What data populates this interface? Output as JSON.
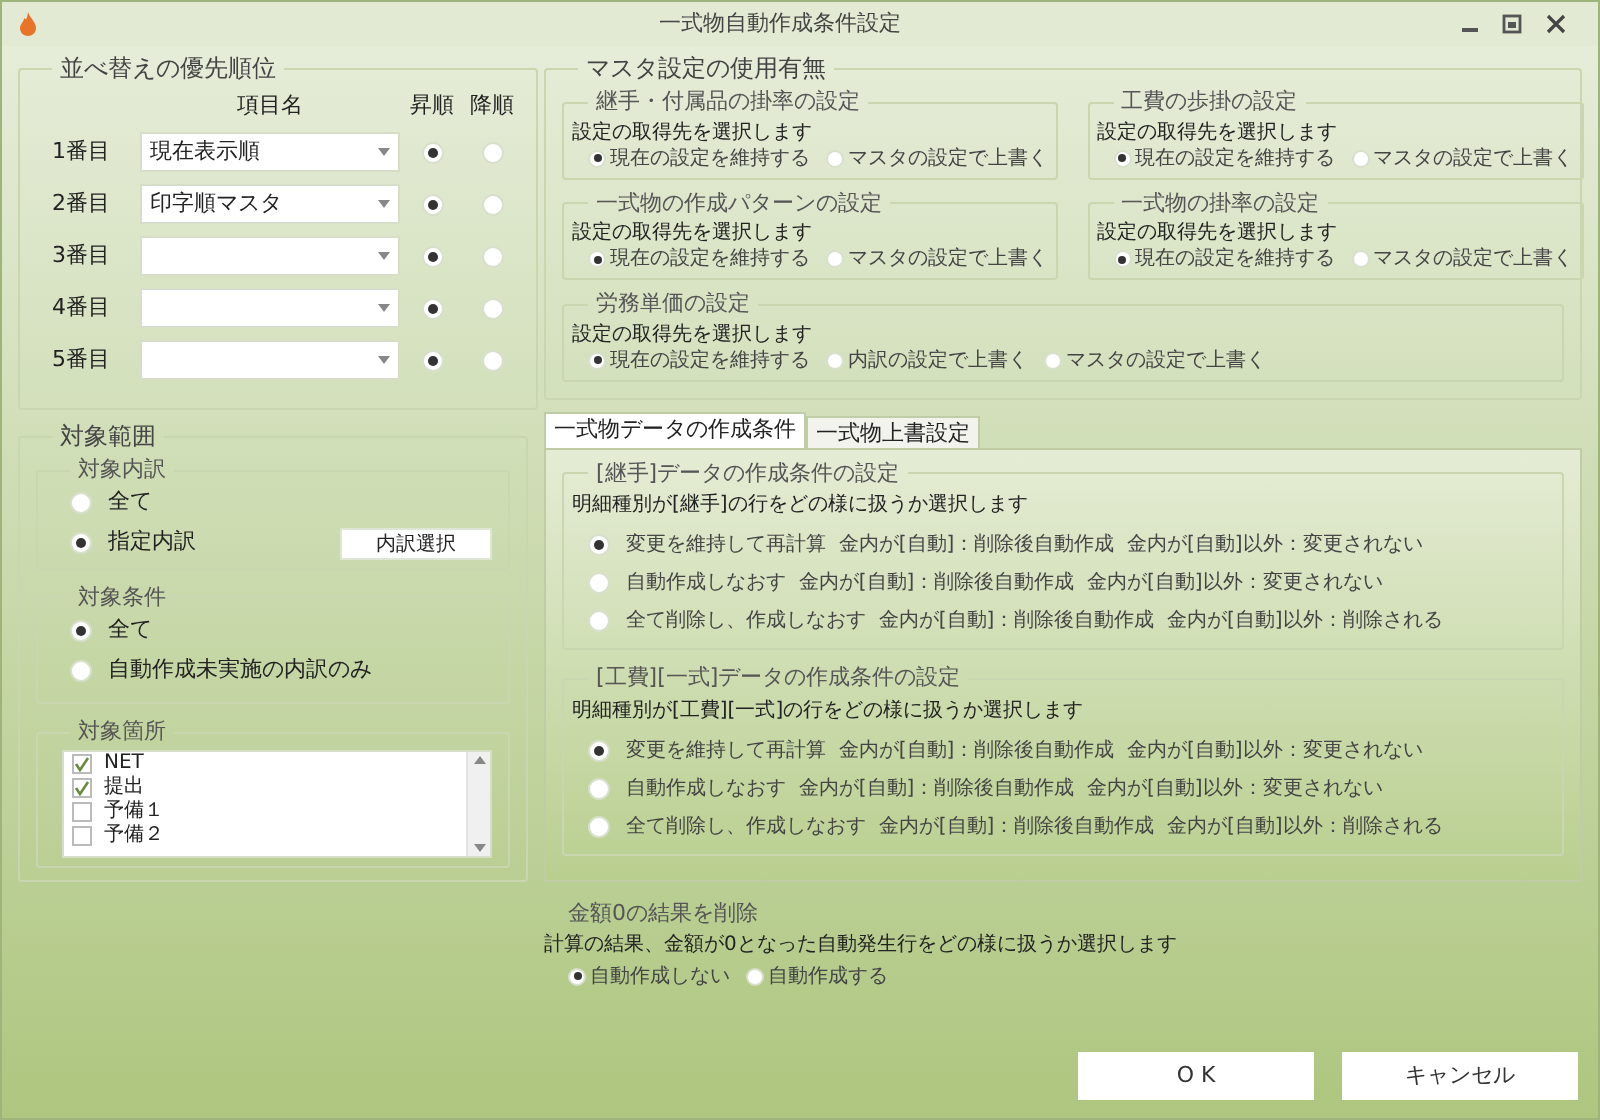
{
  "window": {
    "title": "一式物自動作成条件設定"
  },
  "sort_priority": {
    "title": "並べ替えの優先順位",
    "columns": [
      "項目名",
      "昇順",
      "降順"
    ],
    "rows": [
      {
        "label": "1番目",
        "value": "現在表示順",
        "ascending": true
      },
      {
        "label": "2番目",
        "value": "印字順マスタ",
        "ascending": true
      },
      {
        "label": "3番目",
        "ascending": true
      },
      {
        "label": "4番目",
        "ascending": true
      },
      {
        "label": "5番目",
        "ascending": true
      }
    ]
  },
  "target_range": {
    "title": "対象範囲",
    "breakdown": {
      "title": "対象内訳",
      "options": [
        {
          "label": "全て",
          "selected": false
        },
        {
          "label": "指定内訳",
          "selected": true
        }
      ],
      "button": "内訳選択"
    },
    "condition": {
      "title": "対象条件",
      "options": [
        {
          "label": "全て",
          "selected": true
        },
        {
          "label": "自動作成未実施の内訳のみ",
          "selected": false
        }
      ]
    },
    "locations": {
      "title": "対象箇所",
      "items": [
        {
          "label": "NET",
          "checked": true
        },
        {
          "label": "提出",
          "checked": true
        },
        {
          "label": "予備１",
          "checked": false
        },
        {
          "label": "予備２",
          "checked": false
        }
      ]
    }
  },
  "master_settings": {
    "title": "マスタ設定の使用有無",
    "groups": [
      {
        "title": "継手・付属品の掛率の設定",
        "prompt": "設定の取得先を選択します",
        "options": [
          {
            "label": "現在の設定を維持する",
            "selected": true
          },
          {
            "label": "マスタの設定で上書く",
            "selected": false
          }
        ]
      },
      {
        "title": "工費の歩掛の設定",
        "prompt": "設定の取得先を選択します",
        "options": [
          {
            "label": "現在の設定を維持する",
            "selected": true
          },
          {
            "label": "マスタの設定で上書く",
            "selected": false
          }
        ]
      },
      {
        "title": "一式物の作成パターンの設定",
        "prompt": "設定の取得先を選択します",
        "options": [
          {
            "label": "現在の設定を維持する",
            "selected": true
          },
          {
            "label": "マスタの設定で上書く",
            "selected": false
          }
        ]
      },
      {
        "title": "一式物の掛率の設定",
        "prompt": "設定の取得先を選択します",
        "options": [
          {
            "label": "現在の設定を維持する",
            "selected": true
          },
          {
            "label": "マスタの設定で上書く",
            "selected": false
          }
        ]
      },
      {
        "title": "労務単価の設定",
        "prompt": "設定の取得先を選択します",
        "options": [
          {
            "label": "現在の設定を維持する",
            "selected": true
          },
          {
            "label": "内訳の設定で上書く",
            "selected": false
          },
          {
            "label": "マスタの設定で上書く",
            "selected": false
          }
        ]
      }
    ]
  },
  "tabs": [
    {
      "label": "一式物データの作成条件",
      "selected": true
    },
    {
      "label": "一式物上書設定",
      "selected": false
    }
  ],
  "tab_panel": {
    "groups": [
      {
        "title": "[継手]データの作成条件の設定",
        "prompt": "明細種別が[継手]の行をどの様に扱うか選択します",
        "options": [
          {
            "label": "変更を維持して再計算  金内が[自動]：削除後自動作成  金内が[自動]以外：変更されない",
            "selected": true
          },
          {
            "label": "自動作成しなおす  金内が[自動]：削除後自動作成  金内が[自動]以外：変更されない",
            "selected": false
          },
          {
            "label": "全て削除し、作成しなおす  金内が[自動]：削除後自動作成  金内が[自動]以外：削除される",
            "selected": false
          }
        ]
      },
      {
        "title": "[工費][一式]データの作成条件の設定",
        "prompt": "明細種別が[工費][一式]の行をどの様に扱うか選択します",
        "options": [
          {
            "label": "変更を維持して再計算  金内が[自動]：削除後自動作成  金内が[自動]以外：変更されない",
            "selected": true
          },
          {
            "label": "自動作成しなおす  金内が[自動]：削除後自動作成  金内が[自動]以外：変更されない",
            "selected": false
          },
          {
            "label": "全て削除し、作成しなおす  金内が[自動]：削除後自動作成  金内が[自動]以外：削除される",
            "selected": false
          }
        ]
      }
    ]
  },
  "zero_amount": {
    "title": "金額0の結果を削除",
    "prompt": "計算の結果、金額が0となった自動発生行をどの様に扱うか選択します",
    "options": [
      {
        "label": "自動作成しない",
        "selected": true
      },
      {
        "label": "自動作成する",
        "selected": false
      }
    ]
  },
  "buttons": [
    "O K",
    "キャンセル"
  ]
}
